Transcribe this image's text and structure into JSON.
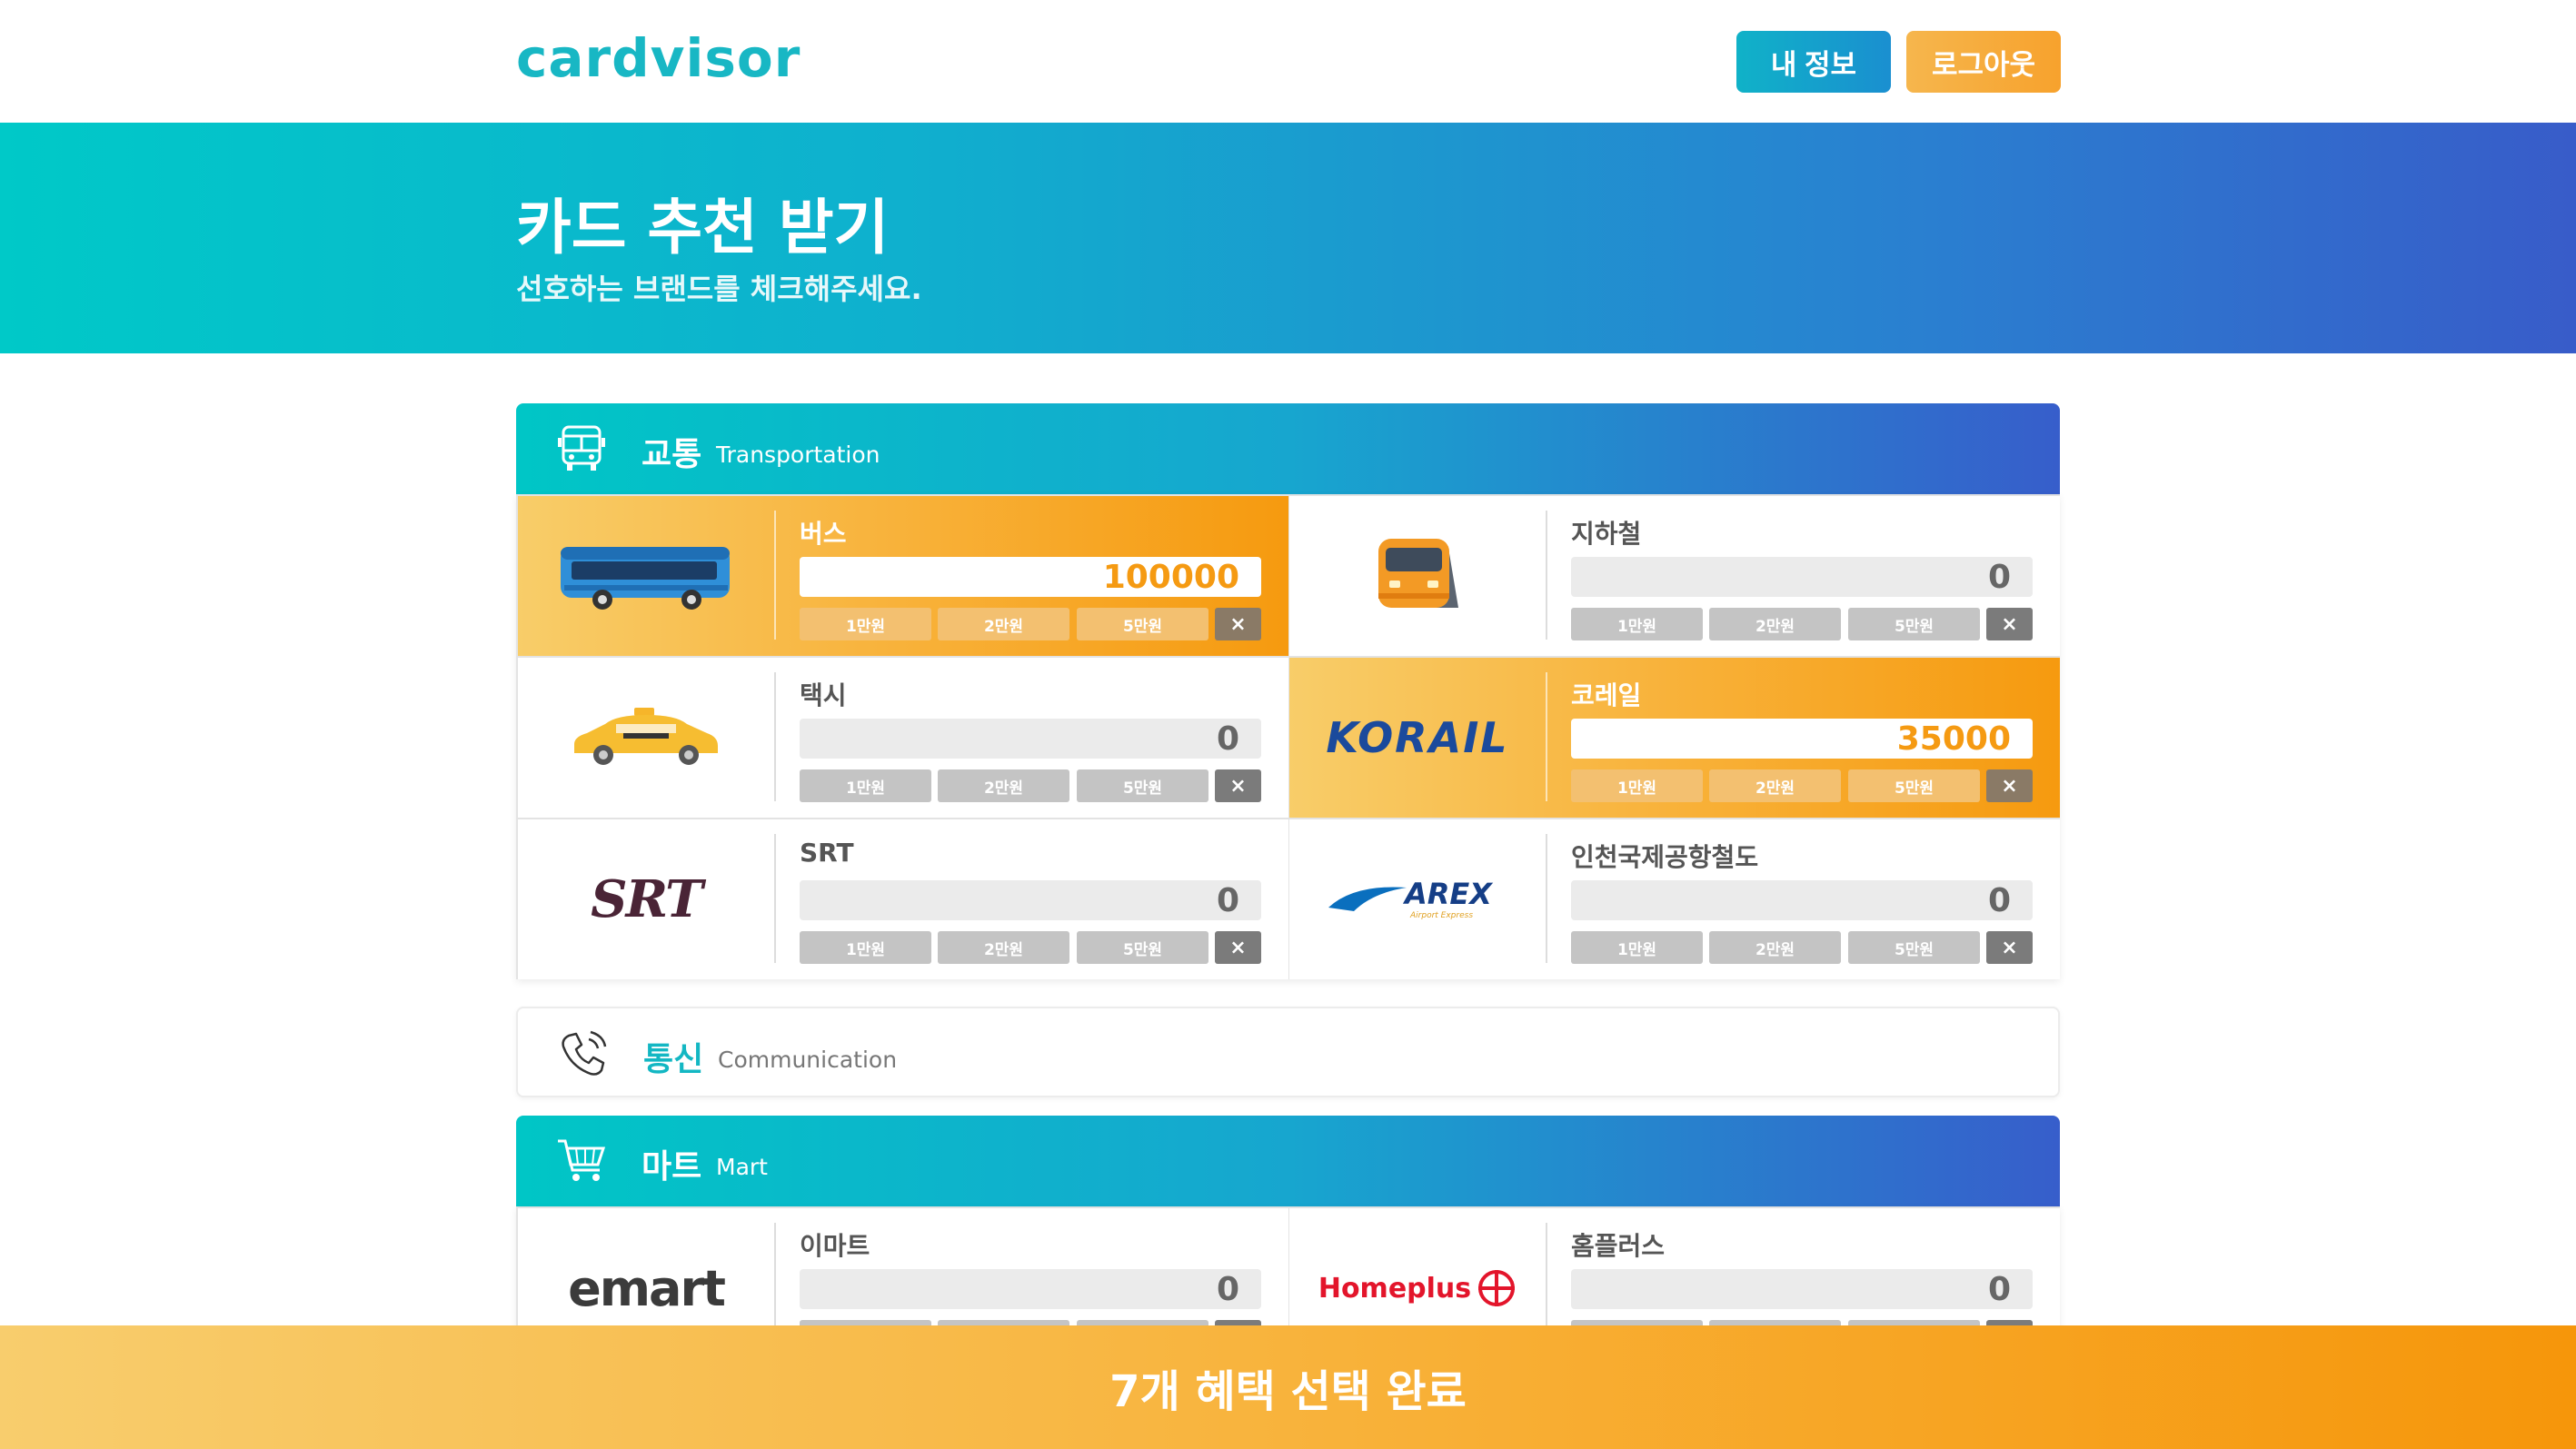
{
  "header": {
    "logo": "cardvisor",
    "my_info_label": "내 정보",
    "logout_label": "로그아웃"
  },
  "hero": {
    "title": "카드 추천 받기",
    "subtitle": "선호하는 브랜드를 체크해주세요."
  },
  "sections": {
    "transportation": {
      "title": "교통",
      "subtitle": "Transportation",
      "icon": "bus-outline-icon"
    },
    "communication": {
      "title": "통신",
      "subtitle": "Communication",
      "icon": "phone-ringing-icon"
    },
    "mart": {
      "title": "마트",
      "subtitle": "Mart",
      "icon": "shopping-cart-icon"
    }
  },
  "chips": {
    "c1": "1만원",
    "c2": "2만원",
    "c3": "5만원",
    "clear": "×"
  },
  "transport_cards": [
    {
      "name": "버스",
      "amount": "100000",
      "selected": true,
      "icon": "bus-icon"
    },
    {
      "name": "지하철",
      "amount": "0",
      "selected": false,
      "icon": "subway-train-icon"
    },
    {
      "name": "택시",
      "amount": "0",
      "selected": false,
      "icon": "taxi-icon"
    },
    {
      "name": "코레일",
      "amount": "35000",
      "selected": true,
      "icon": "korail-logo",
      "logo_text": "KORAIL"
    },
    {
      "name": "SRT",
      "amount": "0",
      "selected": false,
      "icon": "srt-logo",
      "logo_text": "SRT"
    },
    {
      "name": "인천국제공항철도",
      "amount": "0",
      "selected": false,
      "icon": "arex-logo",
      "logo_text": "AREX",
      "logo_sub": "Airport Express"
    }
  ],
  "mart_cards": [
    {
      "name": "이마트",
      "amount": "0",
      "selected": false,
      "icon": "emart-logo",
      "logo_text": "emart"
    },
    {
      "name": "홈플러스",
      "amount": "0",
      "selected": false,
      "icon": "homeplus-logo",
      "logo_text": "Homeplus"
    }
  ],
  "footer": {
    "complete_label": "7개 혜택 선택 완료"
  },
  "colors": {
    "teal": "#13b7c3",
    "blue": "#375ecb",
    "orange": "#f69a0f",
    "chip_gray": "#c4c4c4"
  }
}
